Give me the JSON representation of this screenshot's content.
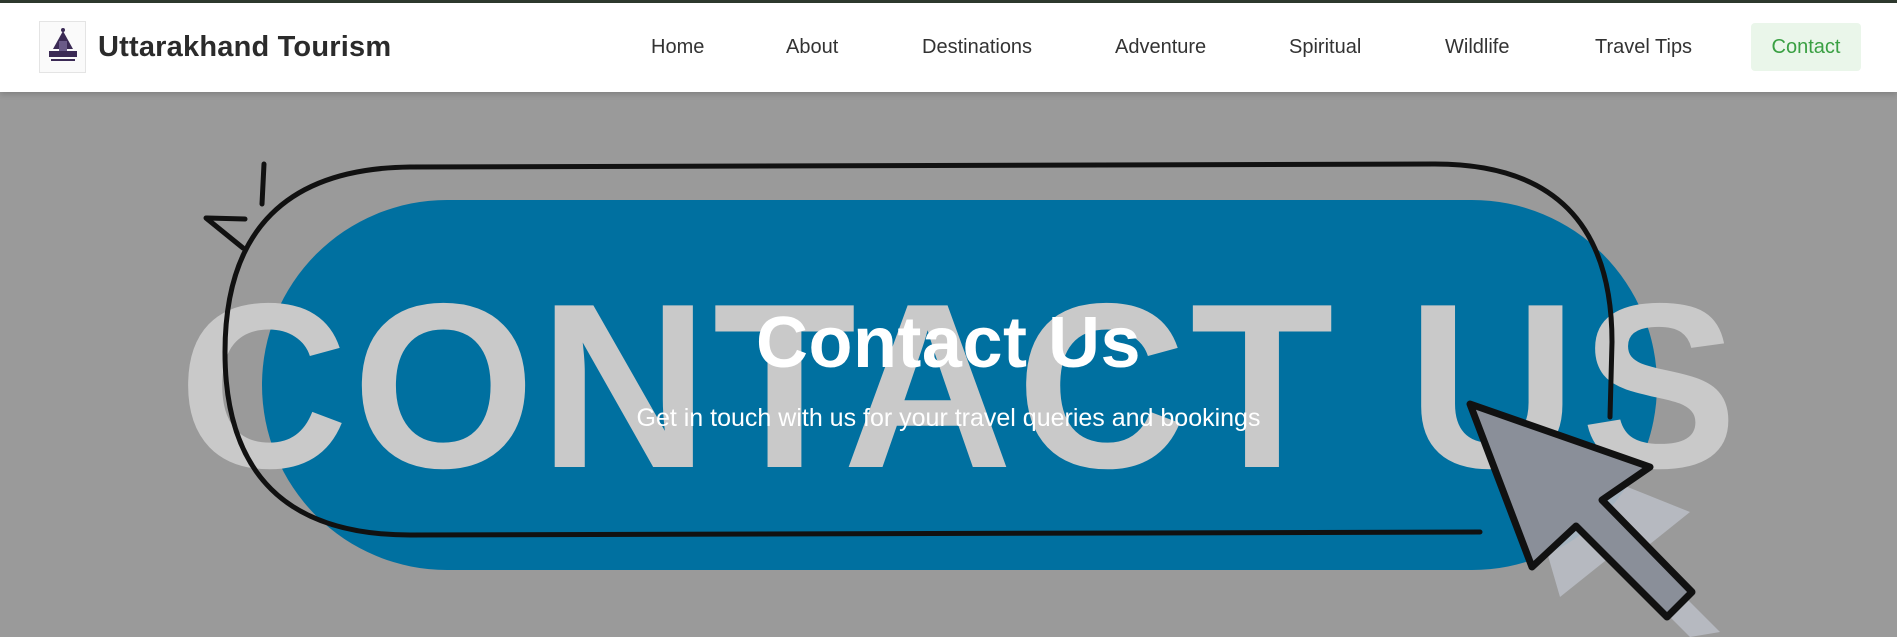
{
  "brand": {
    "title": "Uttarakhand Tourism",
    "logo_icon": "temple-logo-icon"
  },
  "nav": {
    "items": [
      {
        "label": "Home"
      },
      {
        "label": "About"
      },
      {
        "label": "Destinations"
      },
      {
        "label": "Adventure"
      },
      {
        "label": "Spiritual"
      },
      {
        "label": "Wildlife"
      },
      {
        "label": "Travel Tips"
      },
      {
        "label": "Contact",
        "active": true
      }
    ]
  },
  "hero": {
    "title": "Contact Us",
    "subtitle": "Get in touch with us for your travel queries and bookings",
    "background_text": "CONTACT US",
    "colors": {
      "overlay": "#9a9a9a",
      "pill": "#0070a0",
      "accent": "#3aa043"
    }
  }
}
